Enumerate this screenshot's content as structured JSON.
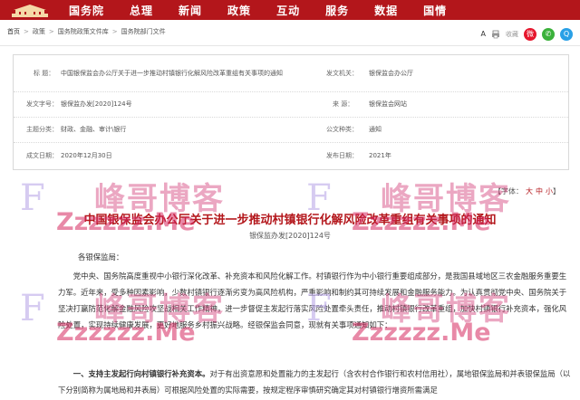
{
  "nav": {
    "items": [
      "国务院",
      "总理",
      "新闻",
      "政策",
      "互动",
      "服务",
      "数据",
      "国情"
    ]
  },
  "breadcrumb": {
    "items": [
      "首页",
      "政策",
      "国务院政策文件库",
      "国务院部门文件"
    ],
    "separator": ">"
  },
  "tools": {
    "font_a": "A",
    "print_label": "收藏",
    "share_icons": [
      "weibo-icon",
      "wechat-icon",
      "qq-icon"
    ]
  },
  "info": {
    "title_label": "标      题：",
    "title_value": "中国银保监会办公厅关于进一步推动村镇银行化解风险改革重组有关事项的通知",
    "issuer_label": "发文机关：",
    "issuer_value": "银保监会办公厅",
    "docno_label": "发文字号：",
    "docno_value": "银保监办发[2020]124号",
    "source_label": "来      源：",
    "source_value": "银保监会网站",
    "topic_label": "主题分类：",
    "topic_value": "财政、金融、审计\\银行",
    "type_label": "公文种类：",
    "type_value": "通知",
    "date_label": "成文日期：",
    "date_value": "2020年12月30日",
    "pubdate_label": "发布日期：",
    "pubdate_value": "2021年"
  },
  "article": {
    "fontsize_label": "【字体：",
    "fontsize_options": [
      "大",
      "中",
      "小"
    ],
    "fontsize_end": "】",
    "title": "中国银保监会办公厅关于进一步推动村镇银行化解风险改革重组有关事项的通知",
    "docno": "银保监办发[2020]124号",
    "salutation": "各银保监局：",
    "para1": "党中央、国务院高度重视中小银行深化改革、补充资本和风险化解工作。村镇银行作为中小银行重要组成部分，是我国县域地区三农金融服务重要生力军。近年来，受多种因素影响，少数村镇银行逐渐劣变为高风险机构，严重影响和制约其可持续发展和金融服务能力。为认真贯彻党中央、国务院关于坚决打赢防范化解金融风险攻坚战相关工作精神，进一步督促主发起行落实风险处置牵头责任，推动村镇银行改革重组，加快村镇银行补充资本，强化风险处置，实现持续健康发展，更好地服务乡村振兴战略。经银保监会同意，现就有关事项通知如下：",
    "para2_bold": "一、支持主发起行向村镇银行补充资本。",
    "para2": "对于有出资意愿和处置能力的主发起行（含农村合作银行和农村信用社），属地银保监局和并表银保监局（以下分别简称为属地局和并表局）可根据风险处置的实际需要，按规定程序审慎研究确定其对村镇银行增资所需满足"
  },
  "watermarks": {
    "brand": "峰哥博客",
    "url": "Zzzzzz.Me",
    "letter": "F"
  },
  "colors": {
    "brand_red": "#b3161b",
    "watermark_pink": "#d23c78"
  }
}
